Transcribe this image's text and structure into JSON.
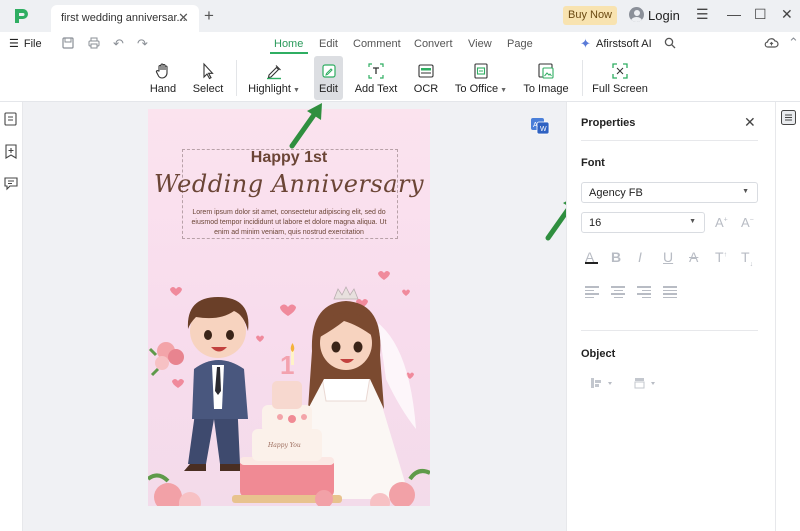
{
  "titlebar": {
    "tab_title": "first wedding anniversar...",
    "tab_close": "✕",
    "new_tab": "+",
    "buy_now": "Buy Now",
    "login": "Login"
  },
  "menubar": {
    "file": "File",
    "tabs": [
      {
        "label": "Home",
        "active": true
      },
      {
        "label": "Edit"
      },
      {
        "label": "Comment"
      },
      {
        "label": "Convert"
      },
      {
        "label": "View"
      },
      {
        "label": "Page"
      }
    ],
    "ai_label": "Afirstsoft AI"
  },
  "toolbar": {
    "tools": [
      {
        "label": "Hand",
        "icon": "hand-icon"
      },
      {
        "label": "Select",
        "icon": "cursor-icon"
      },
      {
        "label": "Highlight",
        "icon": "highlighter-icon"
      },
      {
        "label": "Edit",
        "icon": "edit-icon",
        "selected": true
      },
      {
        "label": "Add Text",
        "icon": "add-text-icon"
      },
      {
        "label": "OCR",
        "icon": "ocr-icon"
      },
      {
        "label": "To Office",
        "icon": "to-office-icon"
      },
      {
        "label": "To Image",
        "icon": "to-image-icon"
      },
      {
        "label": "Full Screen",
        "icon": "full-screen-icon"
      }
    ]
  },
  "document": {
    "heading": "Happy 1st",
    "script_title": "Wedding Anniversary",
    "body": "Lorem ipsum dolor sit amet, consectetur adipiscing elit, sed do eiusmod tempor incididunt ut labore et dolore magna aliqua. Ut enim ad minim veniam, quis nostrud exercitation",
    "cake_topper": "1",
    "cake_text": "Happy You"
  },
  "properties": {
    "title": "Properties",
    "font_section": "Font",
    "font_family": "Agency FB",
    "font_size": "16",
    "object_section": "Object"
  },
  "colors": {
    "accent": "#2fae62",
    "annotation_arrow": "#2f8f3f",
    "page_background": "#fbe3ee",
    "title_text": "#6b4536"
  }
}
